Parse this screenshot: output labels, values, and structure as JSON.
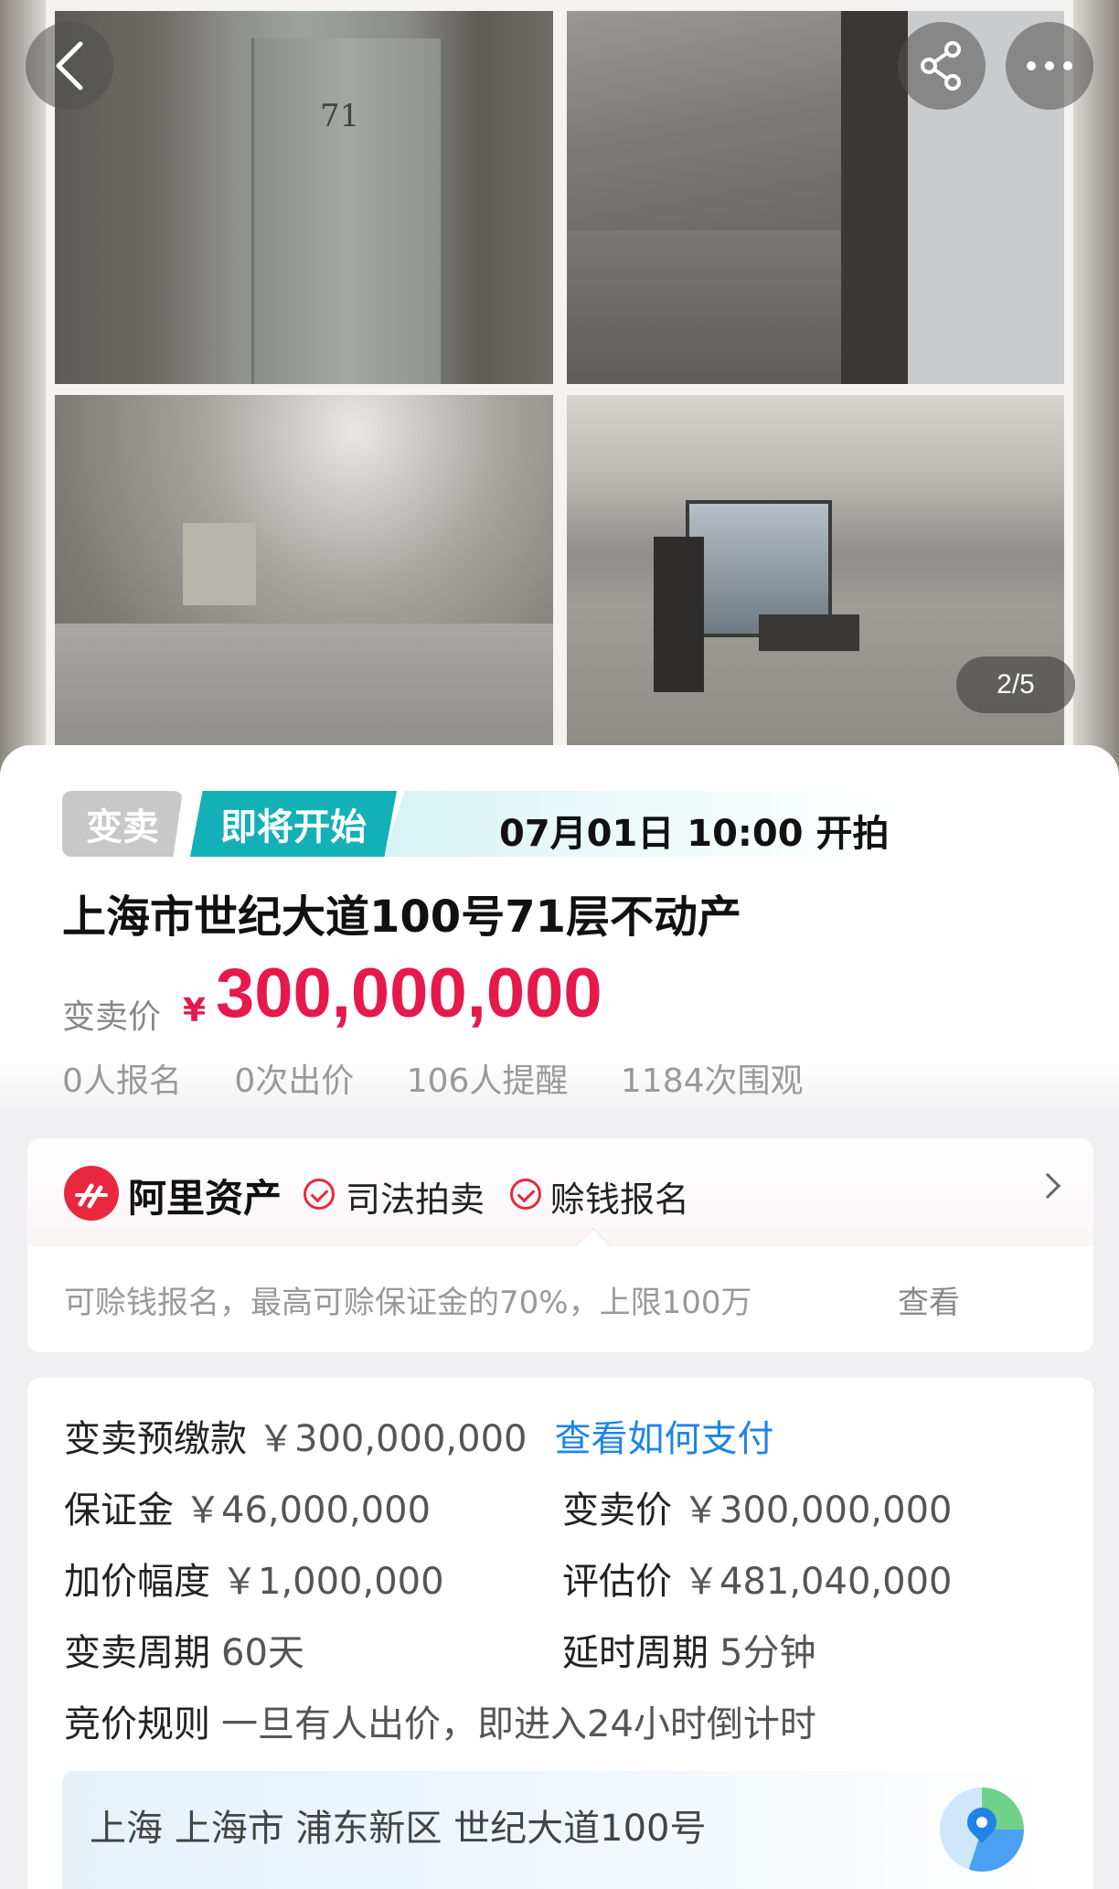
{
  "gallery": {
    "counter": "2/5",
    "photo_door_number": "71"
  },
  "status": {
    "sale_tag": "变卖",
    "soon_tag": "即将开始",
    "start_time": "07月01日 10:00 开拍"
  },
  "title": "上海市世纪大道100号71层不动产",
  "price": {
    "label": "变卖价",
    "currency": "¥",
    "value": "300,000,000"
  },
  "stats": [
    "0人报名",
    "0次出价",
    "106人提醒",
    "1184次围观"
  ],
  "ali": {
    "name": "阿里资产",
    "badge1": "司法拍卖",
    "badge2": "赊钱报名",
    "note": "可赊钱报名，最高可赊保证金的70%，上限100万",
    "view": "查看"
  },
  "info": {
    "prepay_label": "变卖预缴款",
    "prepay_value": "￥300,000,000",
    "prepay_link": "查看如何支付",
    "deposit_label": "保证金",
    "deposit_value": "￥46,000,000",
    "sale_price_label": "变卖价",
    "sale_price_value": "￥300,000,000",
    "increment_label": "加价幅度",
    "increment_value": "￥1,000,000",
    "appraisal_label": "评估价",
    "appraisal_value": "￥481,040,000",
    "period_label": "变卖周期",
    "period_value": "60天",
    "delay_label": "延时周期",
    "delay_value": "5分钟",
    "rule_label": "竞价规则",
    "rule_value": "一旦有人出价，即进入24小时倒计时"
  },
  "address": "上海 上海市 浦东新区 世纪大道100号",
  "icons": {
    "back": "back-arrow-icon",
    "share": "share-icon",
    "more": "more-icon",
    "map": "map-pin-icon"
  },
  "colors": {
    "price_red": "#e6194b",
    "teal": "#14b0b8",
    "link_blue": "#1f84e6",
    "ali_red": "#e8283f"
  }
}
